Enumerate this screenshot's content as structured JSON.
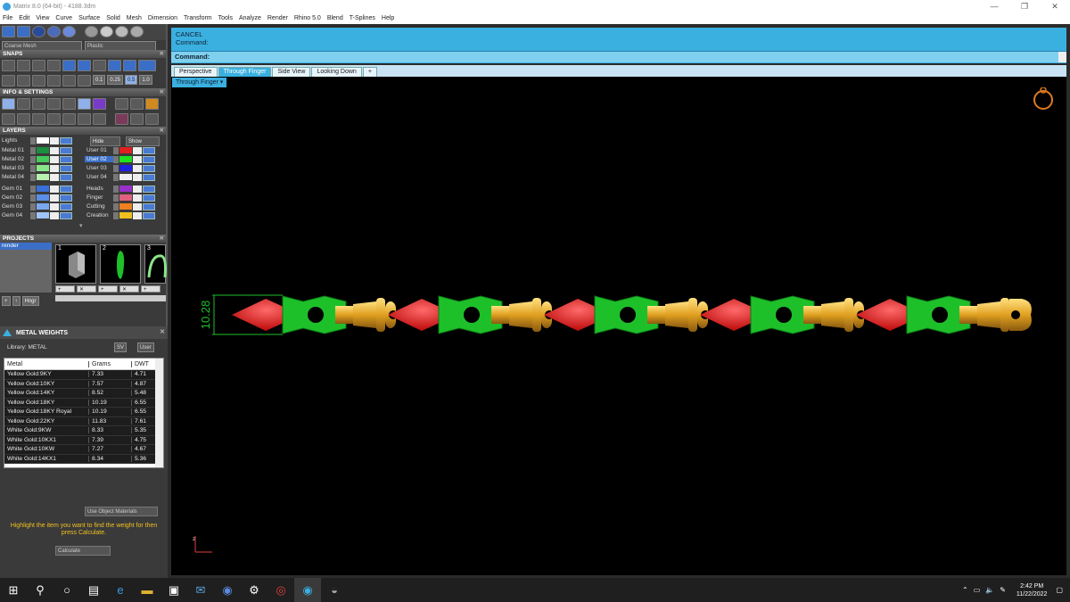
{
  "window": {
    "title": "Matrix 8.0 (64-bit) - 4188.3dm",
    "minimize": "—",
    "maximize": "❐",
    "close": "✕"
  },
  "menu": [
    "File",
    "Edit",
    "View",
    "Curve",
    "Surface",
    "Solid",
    "Mesh",
    "Dimension",
    "Transform",
    "Tools",
    "Analyze",
    "Render",
    "Rhino 5.0",
    "Blend",
    "T-Splines",
    "Help"
  ],
  "toolbar": {
    "mesh_select": "Coarse Mesh",
    "material_select": "Plastic"
  },
  "snaps": {
    "title": "SNAPS",
    "values": [
      "0.1",
      "0.25",
      "0.5",
      "1.0"
    ]
  },
  "info": {
    "title": "INFO & SETTINGS"
  },
  "layers": {
    "title": "LAYERS",
    "hide_label": "Hide",
    "show_label": "Show",
    "left": [
      {
        "name": "Lights",
        "color": "#ffffff"
      },
      {
        "name": "Metal 01",
        "color": "#1c8f3e"
      },
      {
        "name": "Metal 02",
        "color": "#46c85a"
      },
      {
        "name": "Metal 03",
        "color": "#8ae68a"
      },
      {
        "name": "Metal 04",
        "color": "#b8f0b0"
      },
      {
        "name": "Gem 01",
        "color": "#3a6fd8"
      },
      {
        "name": "Gem 02",
        "color": "#5a8fe8"
      },
      {
        "name": "Gem 03",
        "color": "#7aa8f0"
      },
      {
        "name": "Gem 04",
        "color": "#a0c4f8"
      }
    ],
    "right": [
      {
        "name": "User 01",
        "color": "#e02020"
      },
      {
        "name": "User 02",
        "color": "#20e020"
      },
      {
        "name": "User 03",
        "color": "#2020e0"
      },
      {
        "name": "User 04",
        "color": "#f0f0f0"
      },
      {
        "name": "Heads",
        "color": "#9a30c8"
      },
      {
        "name": "Finger",
        "color": "#e06080"
      },
      {
        "name": "Cutting",
        "color": "#f08020"
      },
      {
        "name": "Creation",
        "color": "#f0c020"
      }
    ]
  },
  "projects": {
    "title": "PROJECTS",
    "list": [
      "render"
    ],
    "thumbs": [
      "1",
      "2",
      "3"
    ],
    "hinge_label": "Hngr"
  },
  "metal_weights": {
    "title": "METAL WEIGHTS",
    "library_label": "Library:  METAL",
    "btn_sv": "SV",
    "btn_user": "User",
    "columns": [
      "Metal",
      "Grams",
      "DWT"
    ],
    "rows": [
      [
        "Yellow Gold:9KY",
        "7.33",
        "4.71"
      ],
      [
        "Yellow Gold:10KY",
        "7.57",
        "4.87"
      ],
      [
        "Yellow Gold:14KY",
        "8.52",
        "5.48"
      ],
      [
        "Yellow Gold:18KY",
        "10.19",
        "6.55"
      ],
      [
        "Yellow Gold:18KY Royal",
        "10.19",
        "6.55"
      ],
      [
        "Yellow Gold:22KY",
        "11.83",
        "7.61"
      ],
      [
        "White Gold:9KW",
        "8.33",
        "5.35"
      ],
      [
        "White Gold:10KX1",
        "7.39",
        "4.75"
      ],
      [
        "White Gold:10KW",
        "7.27",
        "4.67"
      ],
      [
        "White Gold:14KX1",
        "8.34",
        "5.36"
      ]
    ],
    "use_object_materials": "Use Object Materials",
    "hint": "Highlight the item you want to find the weight for then press Calculate.",
    "calculate": "Calculate"
  },
  "command": {
    "line1": "CANCEL",
    "line2": "Command:",
    "prompt": "Command:"
  },
  "viewport_tabs": [
    "Perspective",
    "Through Finger",
    "Side View",
    "Looking Down",
    "+"
  ],
  "active_viewport": "Through Finger",
  "dimension": "10.28",
  "taskbar": {
    "time": "2:42 PM",
    "date": "11/22/2022"
  }
}
